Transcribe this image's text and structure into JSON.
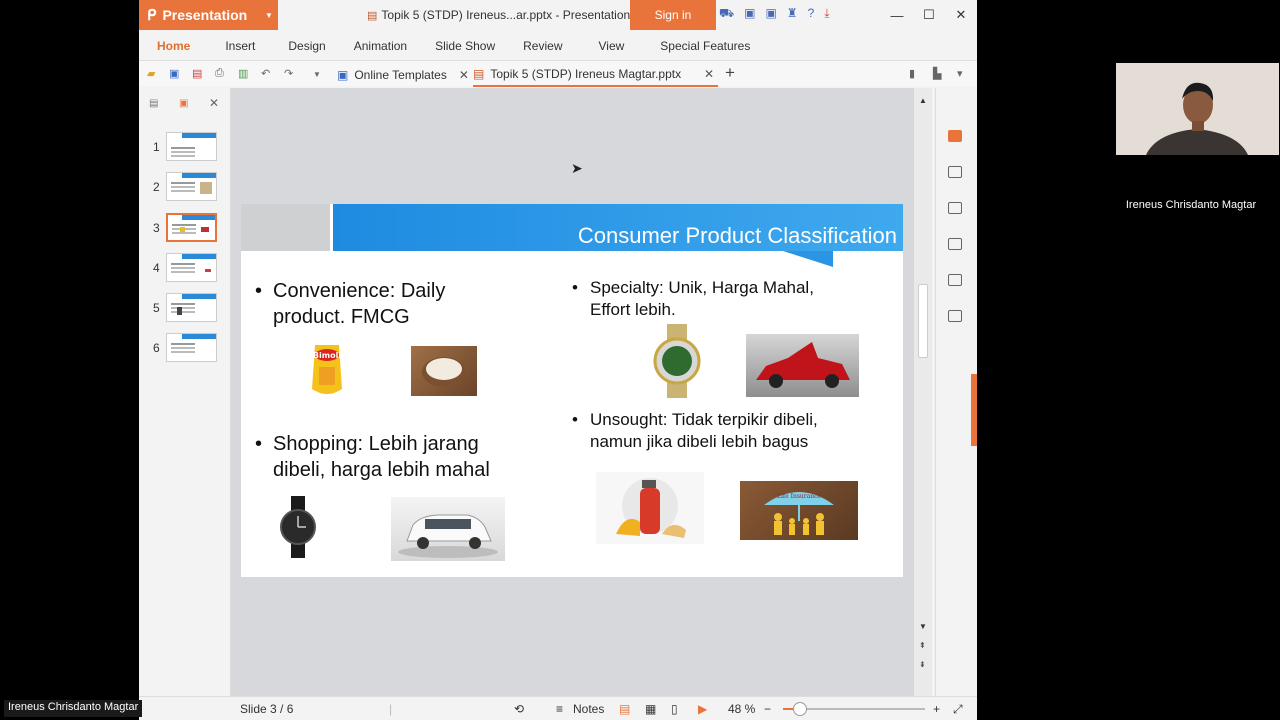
{
  "app": {
    "brand": "Presentation",
    "document_title": "Topik 5 (STDP) Ireneus...ar.pptx - Presentation",
    "sign_in": "Sign in",
    "accent": "#e8743b"
  },
  "menu": [
    {
      "label": "Home",
      "active": true
    },
    {
      "label": "Insert"
    },
    {
      "label": "Design"
    },
    {
      "label": "Animation"
    },
    {
      "label": "Slide Show"
    },
    {
      "label": "Review"
    },
    {
      "label": "View"
    },
    {
      "label": "Special Features"
    }
  ],
  "tabs": {
    "online_templates": "Online Templates",
    "document": "Topik 5 (STDP) Ireneus Magtar.pptx"
  },
  "thumbnails": [
    "1",
    "2",
    "3",
    "4",
    "5",
    "6"
  ],
  "selected_slide": 3,
  "slide": {
    "title": "Consumer Product Classification",
    "b1_line1": "Convenience: Daily",
    "b1_line2": "product. FMCG",
    "b2_line1": "Shopping: Lebih jarang",
    "b2_line2": "dibeli, harga lebih mahal",
    "b3_line1": "Specialty: Unik, Harga Mahal,",
    "b3_line2": "Effort lebih.",
    "b4_line1": "Unsought: Tidak terpikir dibeli,",
    "b4_line2": "namun jika dibeli lebih bagus",
    "bimoli_label": "Bimoli",
    "insurance_label": "Life Insurance"
  },
  "status": {
    "slide_counter": "Slide 3 / 6",
    "notes": "Notes",
    "zoom": "48 %",
    "zoom_level_percent": 48
  },
  "video": {
    "participant_name": "Ireneus Chrisdanto Magtar",
    "self_name": "Ireneus Chrisdanto Magtar"
  }
}
